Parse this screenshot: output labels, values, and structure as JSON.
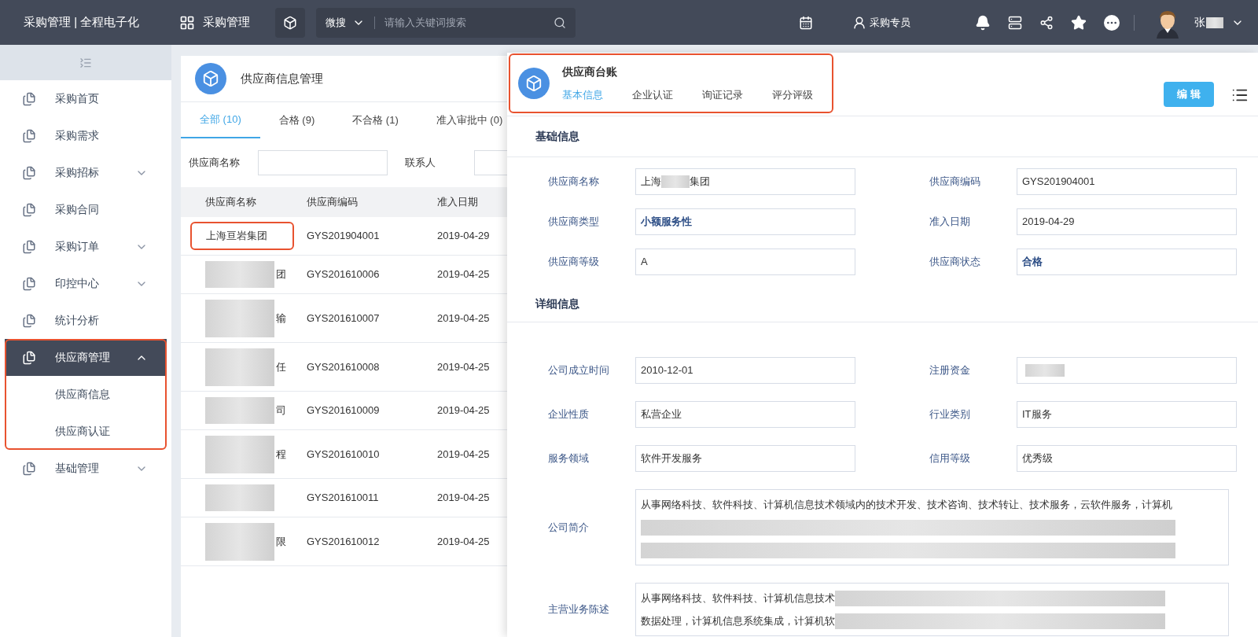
{
  "topbar": {
    "title": "采购管理 | 全程电子化",
    "app_name": "采购管理",
    "search": {
      "scope": "微搜",
      "placeholder": "请输入关键词搜索"
    },
    "role": "采购专员",
    "user": {
      "name": "张",
      "redacted": true
    }
  },
  "sidebar": {
    "items": [
      {
        "label": "采购首页",
        "selected": false
      },
      {
        "label": "采购需求",
        "selected": false
      },
      {
        "label": "采购招标",
        "selected": false,
        "expanded": false
      },
      {
        "label": "采购合同",
        "selected": false
      },
      {
        "label": "采购订单",
        "selected": false,
        "expanded": false
      },
      {
        "label": "印控中心",
        "selected": false,
        "expanded": false
      },
      {
        "label": "统计分析",
        "selected": false
      },
      {
        "label": "供应商管理",
        "selected": true,
        "expanded": true,
        "highlighted": true,
        "children": [
          {
            "label": "供应商信息"
          },
          {
            "label": "供应商认证"
          }
        ]
      },
      {
        "label": "基础管理",
        "selected": false,
        "expanded": false
      }
    ]
  },
  "supplier_list": {
    "title": "供应商信息管理",
    "tabs": [
      {
        "label": "全部 (10)",
        "selected": true
      },
      {
        "label": "合格 (9)",
        "selected": false
      },
      {
        "label": "不合格 (1)",
        "selected": false
      },
      {
        "label": "准入审批中 (0)",
        "selected": false
      }
    ],
    "filters": [
      {
        "label": "供应商名称"
      },
      {
        "label": "联系人"
      }
    ],
    "table": {
      "columns": [
        "供应商名称",
        "供应商编码",
        "准入日期"
      ],
      "rows": [
        {
          "name": "上海亘岩集团",
          "highlighted": true,
          "code": "GYS201904001",
          "date": "2019-04-29"
        },
        {
          "name": "团",
          "redacted": true,
          "code": "GYS201610006",
          "date": "2019-04-25"
        },
        {
          "name": "输",
          "redacted": true,
          "tall": true,
          "code": "GYS201610007",
          "date": "2019-04-25"
        },
        {
          "name": "任",
          "redacted": true,
          "tall": true,
          "code": "GYS201610008",
          "date": "2019-04-25"
        },
        {
          "name": "司",
          "redacted": true,
          "code": "GYS201610009",
          "date": "2019-04-25"
        },
        {
          "name": "程",
          "redacted": true,
          "tall": true,
          "code": "GYS201610010",
          "date": "2019-04-25"
        },
        {
          "redacted": true,
          "code": "GYS201610011",
          "date": "2019-04-25"
        },
        {
          "name": "限",
          "redacted": true,
          "tall": true,
          "code": "GYS201610012",
          "date": "2019-04-25"
        }
      ]
    }
  },
  "detail": {
    "title": "供应商台账",
    "highlighted": true,
    "tabs": [
      {
        "label": "基本信息",
        "selected": true
      },
      {
        "label": "企业认证",
        "selected": false
      },
      {
        "label": "询证记录",
        "selected": false
      },
      {
        "label": "评分评级",
        "selected": false
      }
    ],
    "edit_button": "编 辑",
    "sections": [
      {
        "title": "基础信息",
        "fields": [
          {
            "label": "供应商名称",
            "value": "上海",
            "redacted": true,
            "value_end": "集团"
          },
          {
            "label": "供应商编码",
            "value": "GYS201904001"
          },
          {
            "label": "供应商类型",
            "value": "小额服务性",
            "emphasis": true
          },
          {
            "label": "准入日期",
            "value": "2019-04-29"
          },
          {
            "label": "供应商等级",
            "value": "A"
          },
          {
            "label": "供应商状态",
            "value": "合格",
            "emphasis": true
          }
        ]
      },
      {
        "title": "详细信息",
        "fields": [
          {
            "label": "公司成立时间",
            "value": "2010-12-01"
          },
          {
            "label": "注册资金",
            "redacted": true
          },
          {
            "label": "企业性质",
            "value": "私营企业"
          },
          {
            "label": "行业类别",
            "value": "IT服务"
          },
          {
            "label": "服务领域",
            "value": "软件开发服务"
          },
          {
            "label": "信用等级",
            "value": "优秀级"
          },
          {
            "label": "公司简介",
            "kind": "textarea",
            "lines": [
              {
                "text": "从事网络科技、软件科技、计算机信息技术领域内的技术开发、技术咨询、技术转让、技术服务，云软件服务，计算机"
              },
              {
                "redacted": true
              },
              {
                "redacted": true
              }
            ]
          },
          {
            "label": "主营业务陈述",
            "kind": "textarea",
            "lines": [
              {
                "text": "从事网络科技、软件科技、计算机信息技术",
                "redacted": true
              },
              {
                "text": "数据处理，计算机信息系统集成，计算机软",
                "redacted": true
              }
            ]
          }
        ]
      }
    ]
  }
}
